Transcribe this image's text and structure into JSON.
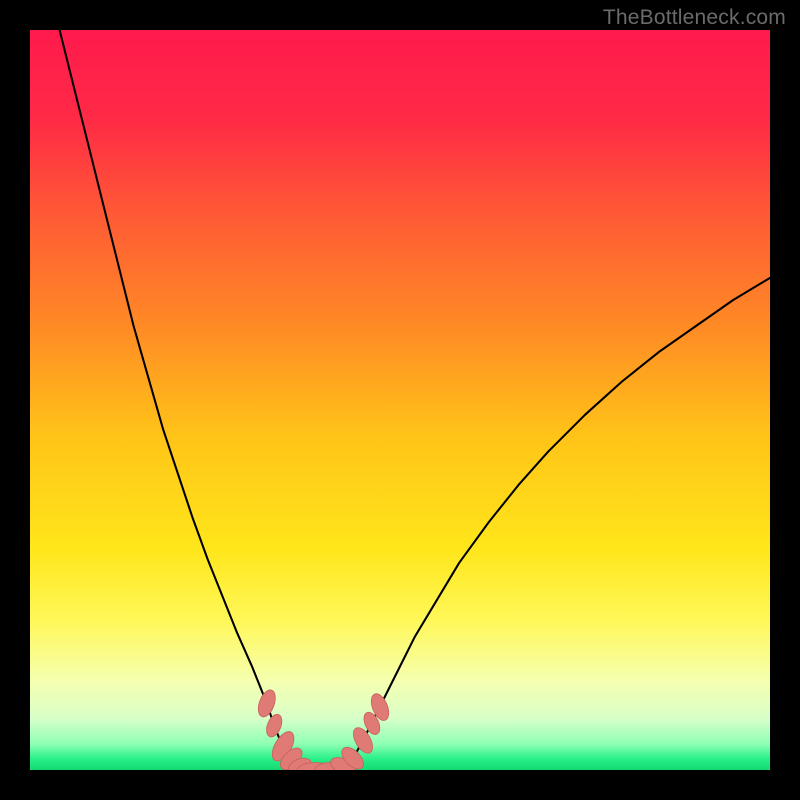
{
  "watermark": "TheBottleneck.com",
  "colors": {
    "frame": "#000000",
    "gradient_stops": [
      {
        "offset": 0.0,
        "color": "#ff1a4d"
      },
      {
        "offset": 0.12,
        "color": "#ff2a46"
      },
      {
        "offset": 0.25,
        "color": "#ff5a35"
      },
      {
        "offset": 0.4,
        "color": "#ff8a25"
      },
      {
        "offset": 0.55,
        "color": "#ffc418"
      },
      {
        "offset": 0.7,
        "color": "#ffe61a"
      },
      {
        "offset": 0.8,
        "color": "#fff85a"
      },
      {
        "offset": 0.88,
        "color": "#f5ffb0"
      },
      {
        "offset": 0.93,
        "color": "#d8ffc8"
      },
      {
        "offset": 0.965,
        "color": "#8dffb4"
      },
      {
        "offset": 0.985,
        "color": "#29f088"
      },
      {
        "offset": 1.0,
        "color": "#14d874"
      }
    ],
    "curve": "#000000",
    "marker_fill": "#df7a75",
    "marker_stroke": "#c9635e"
  },
  "chart_data": {
    "type": "line",
    "title": "",
    "xlabel": "",
    "ylabel": "",
    "xlim": [
      0,
      100
    ],
    "ylim": [
      0,
      100
    ],
    "curve_points": [
      {
        "x": 4.0,
        "y": 100.0
      },
      {
        "x": 6.0,
        "y": 92.0
      },
      {
        "x": 8.0,
        "y": 84.0
      },
      {
        "x": 10.0,
        "y": 76.0
      },
      {
        "x": 12.0,
        "y": 68.0
      },
      {
        "x": 14.0,
        "y": 60.0
      },
      {
        "x": 16.0,
        "y": 53.0
      },
      {
        "x": 18.0,
        "y": 46.0
      },
      {
        "x": 20.0,
        "y": 40.0
      },
      {
        "x": 22.0,
        "y": 34.0
      },
      {
        "x": 24.0,
        "y": 28.5
      },
      {
        "x": 26.0,
        "y": 23.5
      },
      {
        "x": 28.0,
        "y": 18.5
      },
      {
        "x": 30.0,
        "y": 14.0
      },
      {
        "x": 31.0,
        "y": 11.5
      },
      {
        "x": 32.0,
        "y": 9.0
      },
      {
        "x": 33.0,
        "y": 6.0
      },
      {
        "x": 34.0,
        "y": 3.5
      },
      {
        "x": 35.0,
        "y": 1.8
      },
      {
        "x": 36.0,
        "y": 0.8
      },
      {
        "x": 37.0,
        "y": 0.3
      },
      {
        "x": 38.0,
        "y": 0.0
      },
      {
        "x": 39.0,
        "y": 0.0
      },
      {
        "x": 40.0,
        "y": 0.0
      },
      {
        "x": 41.0,
        "y": 0.0
      },
      {
        "x": 42.0,
        "y": 0.3
      },
      {
        "x": 43.0,
        "y": 1.0
      },
      {
        "x": 44.0,
        "y": 2.2
      },
      {
        "x": 45.0,
        "y": 4.0
      },
      {
        "x": 46.0,
        "y": 6.0
      },
      {
        "x": 47.0,
        "y": 8.0
      },
      {
        "x": 48.0,
        "y": 10.0
      },
      {
        "x": 50.0,
        "y": 14.0
      },
      {
        "x": 52.0,
        "y": 18.0
      },
      {
        "x": 55.0,
        "y": 23.0
      },
      {
        "x": 58.0,
        "y": 28.0
      },
      {
        "x": 62.0,
        "y": 33.5
      },
      {
        "x": 66.0,
        "y": 38.5
      },
      {
        "x": 70.0,
        "y": 43.0
      },
      {
        "x": 75.0,
        "y": 48.0
      },
      {
        "x": 80.0,
        "y": 52.5
      },
      {
        "x": 85.0,
        "y": 56.5
      },
      {
        "x": 90.0,
        "y": 60.0
      },
      {
        "x": 95.0,
        "y": 63.5
      },
      {
        "x": 100.0,
        "y": 66.5
      }
    ],
    "markers": [
      {
        "x": 32.0,
        "y": 9.0,
        "rx": 1.0,
        "ry": 1.9,
        "rot": 20
      },
      {
        "x": 33.0,
        "y": 6.0,
        "rx": 0.9,
        "ry": 1.6,
        "rot": 22
      },
      {
        "x": 34.2,
        "y": 3.2,
        "rx": 1.1,
        "ry": 2.2,
        "rot": 30
      },
      {
        "x": 35.3,
        "y": 1.5,
        "rx": 1.0,
        "ry": 1.8,
        "rot": 45
      },
      {
        "x": 36.5,
        "y": 0.5,
        "rx": 1.0,
        "ry": 1.6,
        "rot": 70
      },
      {
        "x": 38.5,
        "y": 0.0,
        "rx": 1.0,
        "ry": 2.4,
        "rot": 90
      },
      {
        "x": 40.5,
        "y": 0.0,
        "rx": 1.0,
        "ry": 2.0,
        "rot": 90
      },
      {
        "x": 42.3,
        "y": 0.5,
        "rx": 1.0,
        "ry": 1.8,
        "rot": 115
      },
      {
        "x": 43.6,
        "y": 1.6,
        "rx": 1.0,
        "ry": 1.8,
        "rot": 135
      },
      {
        "x": 45.0,
        "y": 4.0,
        "rx": 1.0,
        "ry": 1.9,
        "rot": 150
      },
      {
        "x": 46.2,
        "y": 6.3,
        "rx": 0.9,
        "ry": 1.6,
        "rot": 155
      },
      {
        "x": 47.3,
        "y": 8.5,
        "rx": 1.0,
        "ry": 1.9,
        "rot": 158
      }
    ]
  }
}
